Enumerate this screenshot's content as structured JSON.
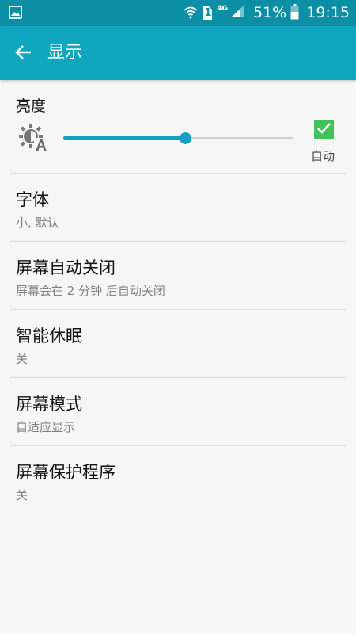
{
  "status_bar": {
    "network_type": "4G",
    "sim_slot": "1",
    "battery": "51%",
    "time": "19:15"
  },
  "app_bar": {
    "title": "显示"
  },
  "brightness": {
    "title": "亮度",
    "level_percent": 53,
    "auto_checked": true,
    "auto_label": "自动"
  },
  "items": [
    {
      "title": "字体",
      "subtitle": "小, 默认"
    },
    {
      "title": "屏幕自动关闭",
      "subtitle": "屏幕会在 2 分钟 后自动关闭"
    },
    {
      "title": "智能休眠",
      "subtitle": "关"
    },
    {
      "title": "屏幕模式",
      "subtitle": "自适应显示"
    },
    {
      "title": "屏幕保护程序",
      "subtitle": "关"
    }
  ],
  "colors": {
    "status_bar": "#0c8ea4",
    "app_bar": "#0fa7bf",
    "slider_accent": "#12a0c3",
    "checkbox": "#42c259"
  },
  "icons": {
    "status_left": "image-notification-icon",
    "wifi": "wifi-icon",
    "sim": "sim-card-icon",
    "signal": "signal-icon",
    "battery": "battery-icon",
    "back": "back-arrow-icon",
    "brightness": "auto-brightness-icon",
    "check": "check-icon"
  }
}
